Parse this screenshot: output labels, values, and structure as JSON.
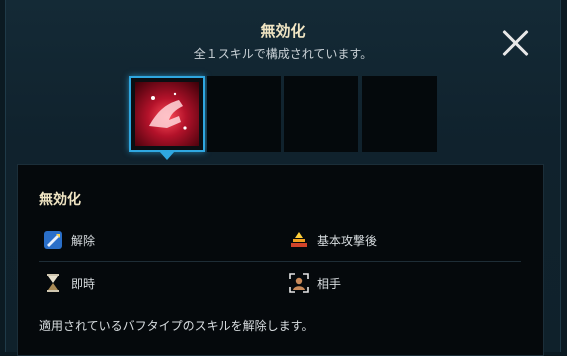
{
  "popup": {
    "title": "無効化",
    "subtitle": "全１スキルで構成されています。"
  },
  "detail": {
    "name": "無効化",
    "attributes": [
      {
        "icon": "release-icon",
        "label": "解除"
      },
      {
        "icon": "after-basic-attack-icon",
        "label": "基本攻撃後"
      },
      {
        "icon": "hourglass-icon",
        "label": "即時"
      },
      {
        "icon": "target-icon",
        "label": "相手"
      }
    ],
    "description": "適用されているバフタイプのスキルを解除します。"
  },
  "colors": {
    "accent": "#2fa7e0",
    "title_gold": "#f1e6c4"
  }
}
